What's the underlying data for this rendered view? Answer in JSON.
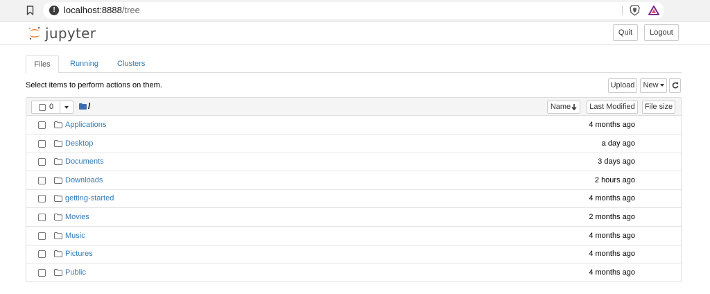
{
  "browser": {
    "url_host": "localhost:8888",
    "url_path": "/tree"
  },
  "header": {
    "logo_text": "jupyter",
    "quit_label": "Quit",
    "logout_label": "Logout"
  },
  "tabs": [
    {
      "label": "Files",
      "active": true
    },
    {
      "label": "Running",
      "active": false
    },
    {
      "label": "Clusters",
      "active": false
    }
  ],
  "toolbar": {
    "instructions": "Select items to perform actions on them.",
    "upload_label": "Upload",
    "new_label": "New",
    "refresh_icon": "refresh-icon"
  },
  "list_header": {
    "selected_count": "0",
    "path": "/",
    "sort_name_label": "Name",
    "sort_modified_label": "Last Modified",
    "sort_size_label": "File size"
  },
  "files": [
    {
      "name": "Applications",
      "modified": "4 months ago",
      "type": "folder"
    },
    {
      "name": "Desktop",
      "modified": "a day ago",
      "type": "folder"
    },
    {
      "name": "Documents",
      "modified": "3 days ago",
      "type": "folder"
    },
    {
      "name": "Downloads",
      "modified": "2 hours ago",
      "type": "folder"
    },
    {
      "name": "getting-started",
      "modified": "4 months ago",
      "type": "folder"
    },
    {
      "name": "Movies",
      "modified": "2 months ago",
      "type": "folder"
    },
    {
      "name": "Music",
      "modified": "4 months ago",
      "type": "folder"
    },
    {
      "name": "Pictures",
      "modified": "4 months ago",
      "type": "folder"
    },
    {
      "name": "Public",
      "modified": "4 months ago",
      "type": "folder"
    }
  ],
  "colors": {
    "link": "#337ab7",
    "jupyter_orange": "#f37726",
    "brave_orange": "#fb542b",
    "rewards_purple": "#662d91"
  }
}
